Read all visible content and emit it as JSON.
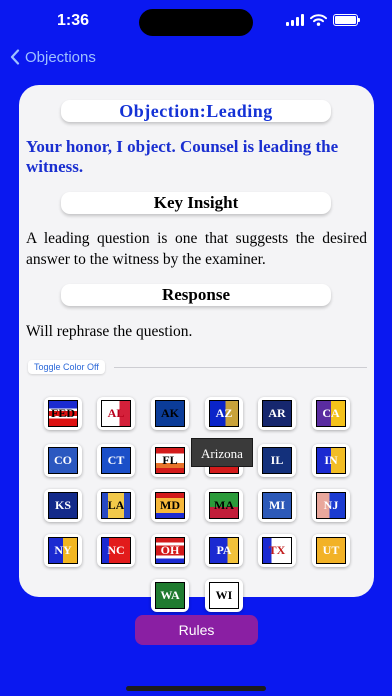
{
  "status": {
    "time": "1:36"
  },
  "nav": {
    "back_label": "Objections"
  },
  "card": {
    "title": "Objection:Leading",
    "objection_text": "Your honor, I object. Counsel is leading the witness.",
    "insight_heading": "Key Insight",
    "insight_text": "A leading question is one that suggests the desired answer to the witness by the examiner.",
    "response_heading": "Response",
    "response_text": "Will rephrase the question.",
    "toggle_label": "Toggle Color Off"
  },
  "states": [
    {
      "code": "FED",
      "style": "fed"
    },
    {
      "code": "AL",
      "style": "al"
    },
    {
      "code": "AK",
      "style": "ak"
    },
    {
      "code": "AZ",
      "style": "az"
    },
    {
      "code": "AR",
      "style": "ar"
    },
    {
      "code": "CA",
      "style": "ca"
    },
    {
      "code": "CO",
      "style": "co"
    },
    {
      "code": "CT",
      "style": "ct"
    },
    {
      "code": "FL",
      "style": "fl"
    },
    {
      "code": "GA",
      "style": "ga"
    },
    {
      "code": "IL",
      "style": "il"
    },
    {
      "code": "IN",
      "style": "in"
    },
    {
      "code": "KS",
      "style": "ks"
    },
    {
      "code": "LA",
      "style": "la"
    },
    {
      "code": "MD",
      "style": "md"
    },
    {
      "code": "MA",
      "style": "ma"
    },
    {
      "code": "MI",
      "style": "mi"
    },
    {
      "code": "NJ",
      "style": "nj"
    },
    {
      "code": "NY",
      "style": "ny"
    },
    {
      "code": "NC",
      "style": "nc"
    },
    {
      "code": "OH",
      "style": "oh"
    },
    {
      "code": "PA",
      "style": "pa"
    },
    {
      "code": "TX",
      "style": "tx"
    },
    {
      "code": "UT",
      "style": "ut"
    },
    {
      "code": "WA",
      "style": "wa"
    },
    {
      "code": "WI",
      "style": "wi"
    }
  ],
  "tooltip": "Arizona",
  "footer": {
    "rules_label": "Rules"
  },
  "colors": {
    "background": "#0a18f0",
    "accent_text": "#1432d6",
    "rules_button": "#8a1fa3"
  }
}
